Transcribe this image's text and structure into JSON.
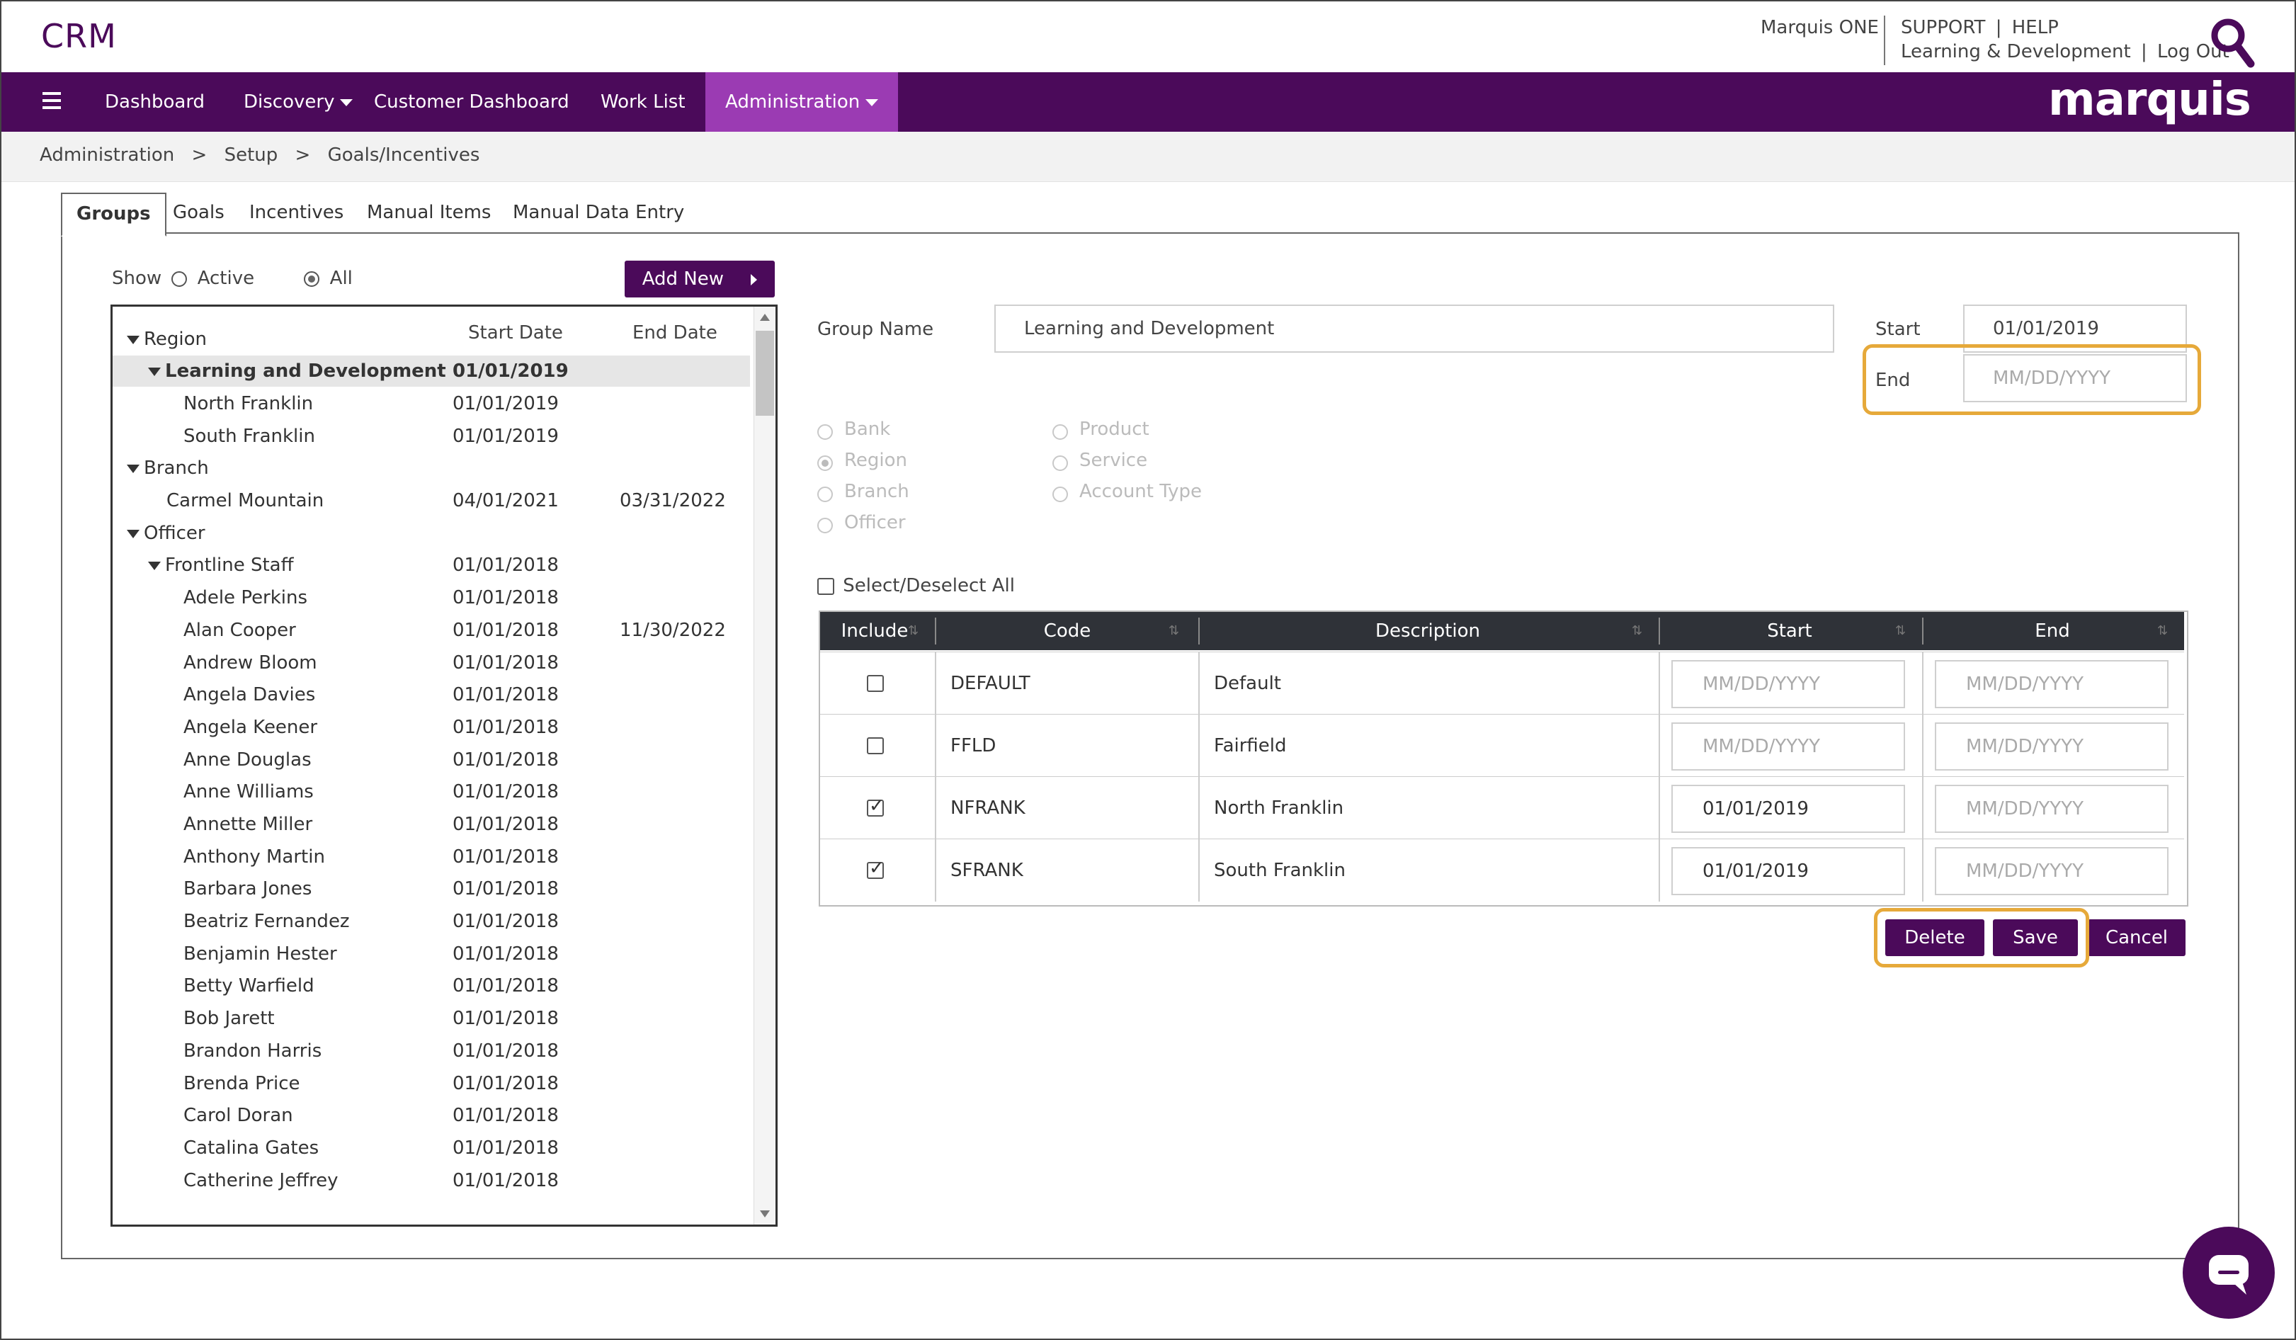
{
  "app": {
    "title": "CRM"
  },
  "top_links": {
    "marquis_one": "Marquis ONE",
    "support": "SUPPORT",
    "sep1": "|",
    "help": "HELP",
    "user": "Learning & Development",
    "sep2": "|",
    "logout": "Log Out"
  },
  "nav": {
    "items": [
      {
        "label": "Dashboard"
      },
      {
        "label": "Discovery"
      },
      {
        "label": "Customer Dashboard"
      },
      {
        "label": "Work List"
      },
      {
        "label": "Administration"
      }
    ],
    "brand": "marquis"
  },
  "breadcrumb": {
    "items": [
      "Administration",
      "Setup",
      "Goals/Incentives"
    ],
    "sep": ">"
  },
  "tabs": [
    "Groups",
    "Goals",
    "Incentives",
    "Manual Items",
    "Manual Data Entry"
  ],
  "filter": {
    "show_label": "Show",
    "active_label": "Active",
    "all_label": "All",
    "selected": "All"
  },
  "add_new_label": "Add New",
  "tree": {
    "headers": {
      "start": "Start Date",
      "end": "End Date"
    },
    "rows": [
      {
        "label": "Region",
        "start": "",
        "end": "",
        "level": 0,
        "expandable": true
      },
      {
        "label": "Learning and Development",
        "start": "01/01/2019",
        "end": "",
        "level": 1,
        "expandable": true,
        "selected": true
      },
      {
        "label": "North Franklin",
        "start": "01/01/2019",
        "end": "",
        "level": 2
      },
      {
        "label": "South Franklin",
        "start": "01/01/2019",
        "end": "",
        "level": 2
      },
      {
        "label": "Branch",
        "start": "",
        "end": "",
        "level": 0,
        "expandable": true
      },
      {
        "label": "Carmel Mountain",
        "start": "04/01/2021",
        "end": "03/31/2022",
        "level": 1
      },
      {
        "label": "Officer",
        "start": "",
        "end": "",
        "level": 0,
        "expandable": true
      },
      {
        "label": "Frontline Staff",
        "start": "01/01/2018",
        "end": "",
        "level": 1,
        "expandable": true
      },
      {
        "label": "Adele Perkins",
        "start": "01/01/2018",
        "end": "",
        "level": 2
      },
      {
        "label": "Alan Cooper",
        "start": "01/01/2018",
        "end": "11/30/2022",
        "level": 2
      },
      {
        "label": "Andrew Bloom",
        "start": "01/01/2018",
        "end": "",
        "level": 2
      },
      {
        "label": "Angela Davies",
        "start": "01/01/2018",
        "end": "",
        "level": 2
      },
      {
        "label": "Angela Keener",
        "start": "01/01/2018",
        "end": "",
        "level": 2
      },
      {
        "label": "Anne Douglas",
        "start": "01/01/2018",
        "end": "",
        "level": 2
      },
      {
        "label": "Anne Williams",
        "start": "01/01/2018",
        "end": "",
        "level": 2
      },
      {
        "label": "Annette Miller",
        "start": "01/01/2018",
        "end": "",
        "level": 2
      },
      {
        "label": "Anthony Martin",
        "start": "01/01/2018",
        "end": "",
        "level": 2
      },
      {
        "label": "Barbara Jones",
        "start": "01/01/2018",
        "end": "",
        "level": 2
      },
      {
        "label": "Beatriz Fernandez",
        "start": "01/01/2018",
        "end": "",
        "level": 2
      },
      {
        "label": "Benjamin Hester",
        "start": "01/01/2018",
        "end": "",
        "level": 2
      },
      {
        "label": "Betty Warfield",
        "start": "01/01/2018",
        "end": "",
        "level": 2
      },
      {
        "label": "Bob Jarett",
        "start": "01/01/2018",
        "end": "",
        "level": 2
      },
      {
        "label": "Brandon Harris",
        "start": "01/01/2018",
        "end": "",
        "level": 2
      },
      {
        "label": "Brenda Price",
        "start": "01/01/2018",
        "end": "",
        "level": 2
      },
      {
        "label": "Carol Doran",
        "start": "01/01/2018",
        "end": "",
        "level": 2
      },
      {
        "label": "Catalina Gates",
        "start": "01/01/2018",
        "end": "",
        "level": 2
      },
      {
        "label": "Catherine Jeffrey",
        "start": "01/01/2018",
        "end": "",
        "level": 2
      }
    ]
  },
  "form": {
    "group_name_label": "Group Name",
    "group_name_value": "Learning and Development",
    "start_label": "Start",
    "start_value": "01/01/2019",
    "end_label": "End",
    "end_placeholder": "MM/DD/YYYY",
    "type_options_left": [
      {
        "label": "Bank",
        "selected": false
      },
      {
        "label": "Region",
        "selected": true
      },
      {
        "label": "Branch",
        "selected": false
      },
      {
        "label": "Officer",
        "selected": false
      }
    ],
    "type_options_right": [
      {
        "label": "Product",
        "selected": false
      },
      {
        "label": "Service",
        "selected": false
      },
      {
        "label": "Account Type",
        "selected": false
      }
    ],
    "select_all_label": "Select/Deselect All"
  },
  "grid": {
    "headers": [
      "Include",
      "Code",
      "Description",
      "Start",
      "End"
    ],
    "date_placeholder": "MM/DD/YYYY",
    "rows": [
      {
        "include": false,
        "code": "DEFAULT",
        "description": "Default",
        "start": "",
        "end": ""
      },
      {
        "include": false,
        "code": "FFLD",
        "description": "Fairfield",
        "start": "",
        "end": ""
      },
      {
        "include": true,
        "code": "NFRANK",
        "description": "North Franklin",
        "start": "01/01/2019",
        "end": ""
      },
      {
        "include": true,
        "code": "SFRANK",
        "description": "South Franklin",
        "start": "01/01/2019",
        "end": ""
      }
    ]
  },
  "actions": {
    "delete": "Delete",
    "save": "Save",
    "cancel": "Cancel"
  },
  "colors": {
    "brand": "#4b0a5a",
    "nav_active": "#9b3bb3",
    "highlight": "#e6a93a",
    "grid_header": "#2f3238"
  },
  "icons": {
    "menu": "hamburger-icon",
    "search": "search-icon",
    "chat": "chat-icon",
    "add": "caret-right-icon"
  }
}
